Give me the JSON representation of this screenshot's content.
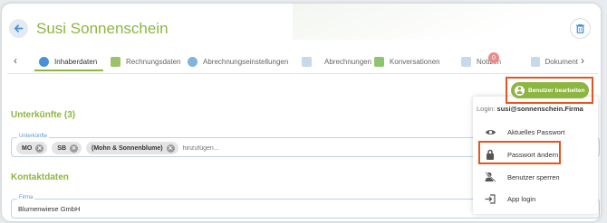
{
  "header": {
    "title": "Susi Sonnenschein"
  },
  "tabs": [
    {
      "label": "Inhaberdaten",
      "active": true,
      "icon": "info-icon"
    },
    {
      "label": "Rechnungsdaten",
      "icon": "invoice-icon"
    },
    {
      "label": "Abrechnungseinstellungen",
      "icon": "gear-icon"
    },
    {
      "label": "Abrechnungen",
      "icon": "document-icon"
    },
    {
      "label": "Konversationen",
      "icon": "chat-icon"
    },
    {
      "label": "Notizen",
      "icon": "note-icon",
      "badge": "0"
    },
    {
      "label": "Dokument",
      "icon": "document-icon"
    }
  ],
  "accommodations": {
    "title": "Unterkünfte (3)",
    "field_label": "Unterkünfte",
    "chips": [
      "MO",
      "SB",
      "(Mohn & Sonnenblume)"
    ],
    "placeholder": "hinzufügen..."
  },
  "contact": {
    "title": "Kontaktdaten",
    "company_label": "Firma",
    "company_value": "Blumenwiese GmbH"
  },
  "user_menu": {
    "edit_button": "Benutzer bearbeiten",
    "login_label": "Login:",
    "login_value": "susi@sonnenschein.Firma",
    "items": [
      {
        "label": "Aktuelles Passwort",
        "icon": "eye-icon"
      },
      {
        "label": "Passwort ändern",
        "icon": "lock-icon"
      },
      {
        "label": "Benutzer sperren",
        "icon": "user-block-icon"
      },
      {
        "label": "App login",
        "icon": "login-icon"
      }
    ]
  },
  "colors": {
    "accent": "#8db641",
    "highlight": "#e8541e",
    "field_border": "#b9d3ea",
    "link_blue": "#5a9ad1"
  }
}
